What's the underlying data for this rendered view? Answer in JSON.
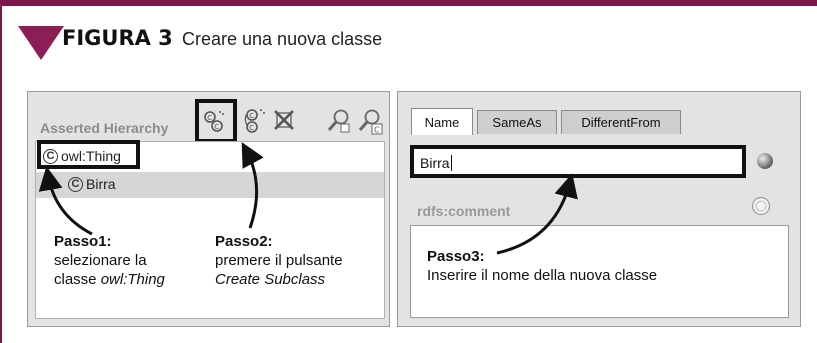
{
  "figure": {
    "label": "FIGURA 3",
    "caption": "Creare una nuova classe"
  },
  "left_panel": {
    "title": "Asserted Hierarchy",
    "toolbar_icons": [
      "create-subclass-icon",
      "create-sibling-class-icon",
      "delete-class-icon",
      "find-class-icon",
      "find-usage-icon"
    ],
    "tree": [
      {
        "label": "owl:Thing",
        "icon": "C"
      },
      {
        "label": "Birra",
        "icon": "C"
      }
    ]
  },
  "right_panel": {
    "tabs": [
      "Name",
      "SameAs",
      "DifferentFrom"
    ],
    "name_value": "Birra",
    "comment_label": "rdfs:comment"
  },
  "annotations": {
    "passo1": {
      "title": "Passo1:",
      "line1": "selezionare la",
      "line2_prefix": "classe ",
      "line2_italic": "owl:Thing"
    },
    "passo2": {
      "title": "Passo2:",
      "line1": "premere il pulsante",
      "line2_italic": "Create Subclass"
    },
    "passo3": {
      "title": "Passo3:",
      "line1": "Inserire il nome della nuova classe"
    }
  },
  "colors": {
    "accent": "#8b1f55",
    "panel_bg": "#e3e3e3",
    "highlight_border": "#111111"
  }
}
